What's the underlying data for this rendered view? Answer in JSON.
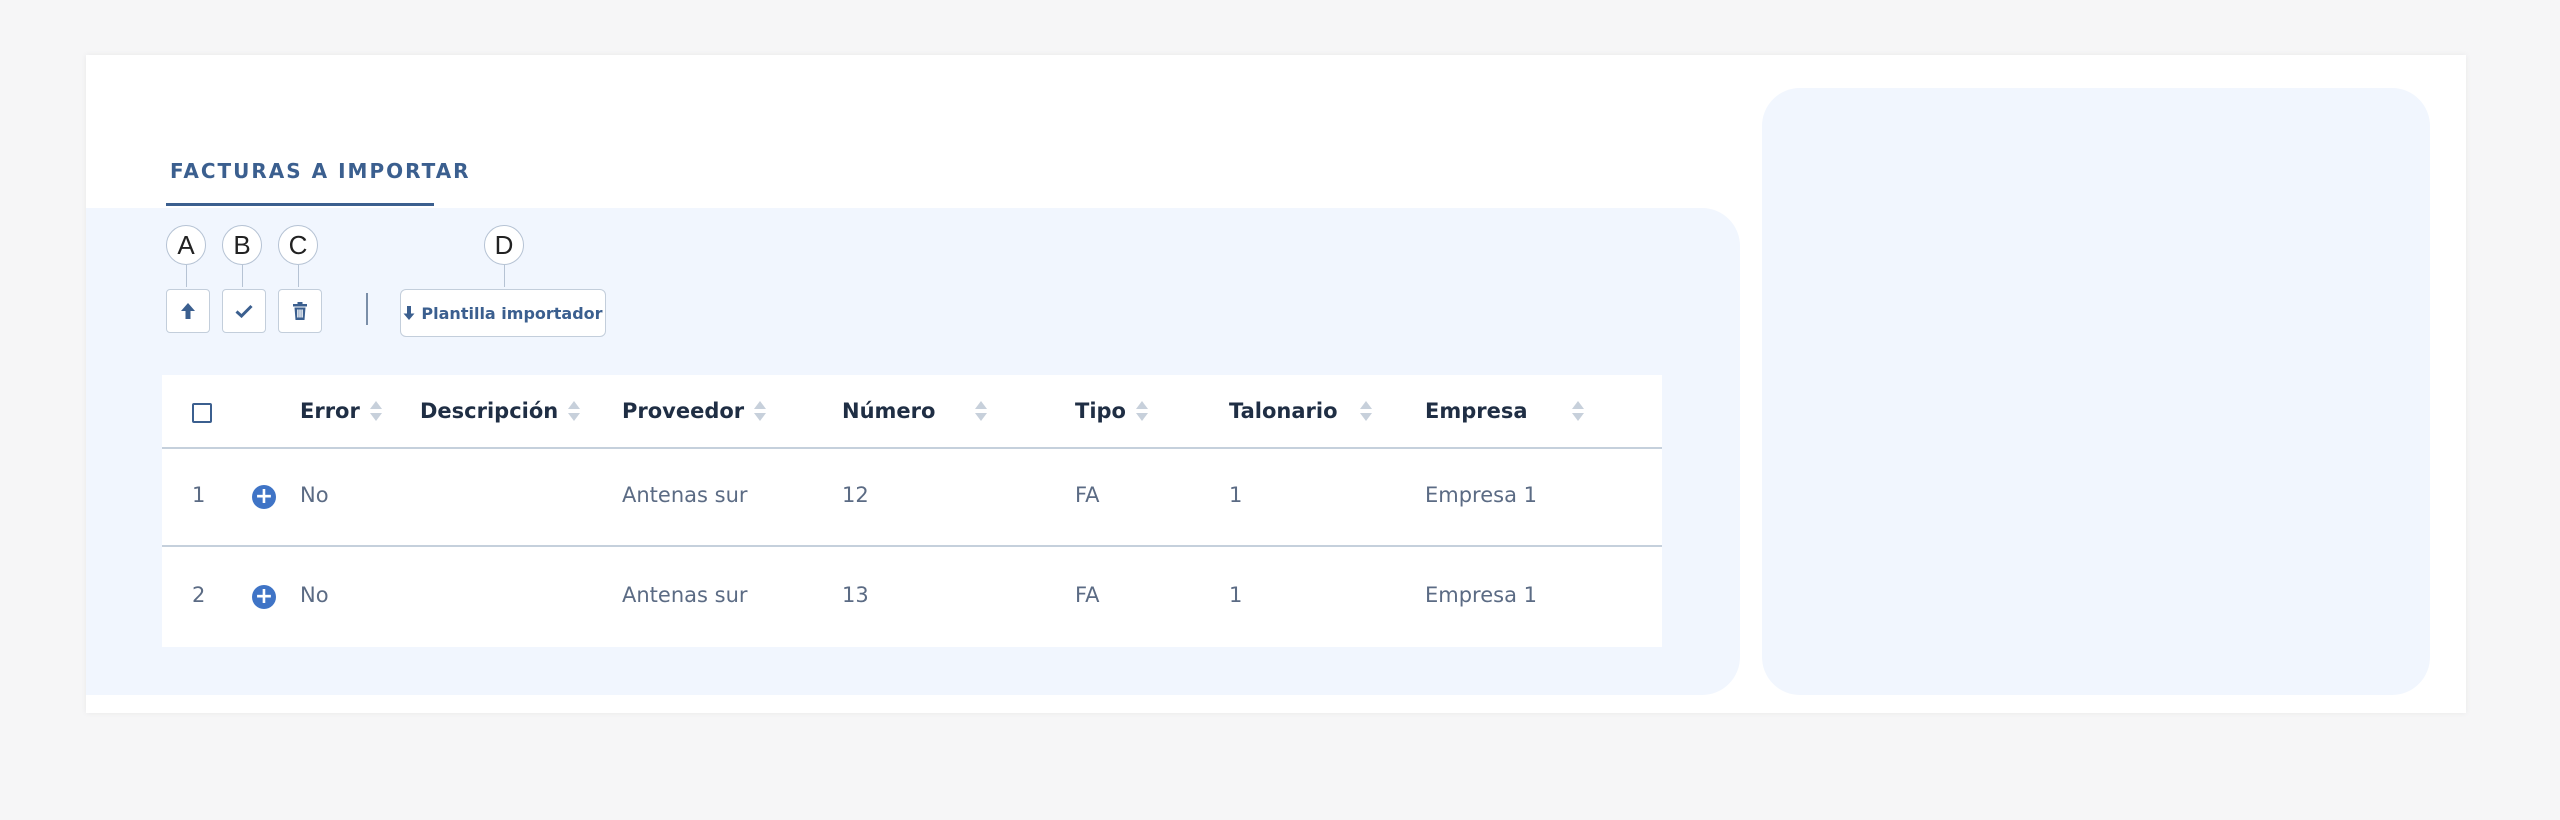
{
  "section": {
    "title": "FACTURAS A IMPORTAR"
  },
  "markers": [
    "A",
    "B",
    "C",
    "D"
  ],
  "toolbar": {
    "upload_icon": "arrow-up-icon",
    "confirm_icon": "check-icon",
    "delete_icon": "trash-icon",
    "template_icon": "arrow-down-icon",
    "template_label": "Plantilla importador"
  },
  "colors": {
    "accent": "#3b5f8f",
    "panel_bg": "#f1f6fe",
    "plus_icon": "#3f74c6"
  },
  "table": {
    "columns": [
      "Error",
      "Descripción",
      "Proveedor",
      "Número",
      "Tipo",
      "Talonario",
      "Empresa"
    ],
    "rows": [
      {
        "index": "1",
        "error": "No",
        "descripcion": "",
        "proveedor": "Antenas sur",
        "numero": "12",
        "tipo": "FA",
        "talonario": "1",
        "empresa": "Empresa 1"
      },
      {
        "index": "2",
        "error": "No",
        "descripcion": "",
        "proveedor": "Antenas sur",
        "numero": "13",
        "tipo": "FA",
        "talonario": "1",
        "empresa": "Empresa 1"
      }
    ]
  }
}
